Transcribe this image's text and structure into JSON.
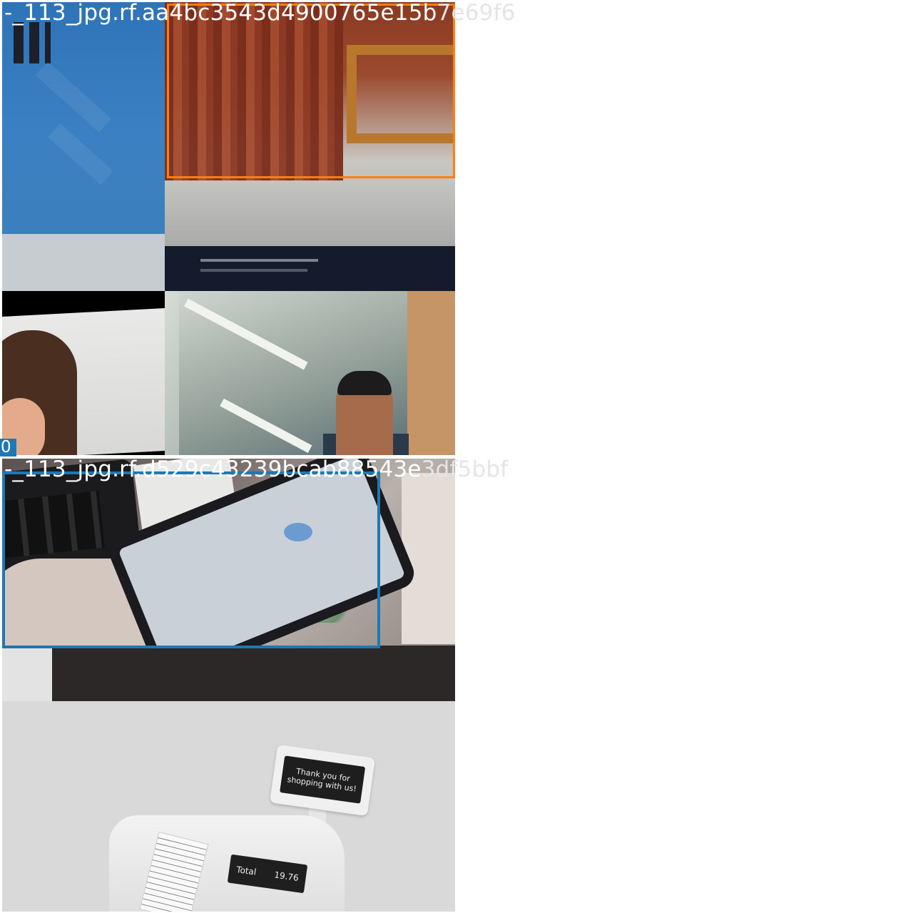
{
  "tiles": [
    {
      "filename": "-_113_jpg.rf.aa4bc3543d4900765e15b7e69f6",
      "filename_parts": [
        "-_113_jpg.rf.aa4bc3543d4900765e15b",
        "7e69f6"
      ],
      "box_color": "#ff7f0e"
    },
    {
      "filename": "-_113_jpg.rf.d529c43239bcab88543e3df5bbf",
      "filename_parts": [
        "-_113_jpg.rf.d529c43239bcab88543e",
        "3df5bbf"
      ],
      "box_color": "#1f77b4",
      "class_label": "0"
    }
  ],
  "register": {
    "display_text": "Thank you for shopping with us!",
    "total_label": "Total",
    "total_value": "19.76"
  }
}
